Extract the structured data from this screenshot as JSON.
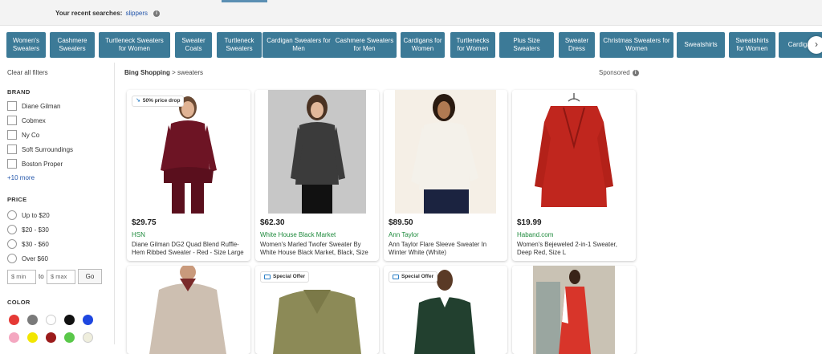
{
  "recent_searches": {
    "label": "Your recent searches:",
    "term": "slippers"
  },
  "chips": [
    "Women's Sweaters",
    "Cashmere Sweaters",
    "Turtleneck Sweaters for Women",
    "Sweater Coats",
    "Turtleneck Sweaters",
    "Cardigan Sweaters for Men",
    "Cashmere Sweaters for Men",
    "Cardigans for Women",
    "Turtlenecks for Women",
    "Plus Size Sweaters",
    "Sweater Dress",
    "Christmas Sweaters for Women",
    "Sweatshirts",
    "Sweatshirts for Women",
    "Cardigans"
  ],
  "sidebar": {
    "clear_all": "Clear all filters",
    "brand_title": "BRAND",
    "brands": [
      "Diane Gilman",
      "Cobmex",
      "Ny Co",
      "Soft Surroundings",
      "Boston Proper"
    ],
    "more": "+10 more",
    "price_title": "PRICE",
    "prices": [
      "Up to $20",
      "$20 - $30",
      "$30 - $60",
      "Over $60"
    ],
    "min_placeholder": "$ min",
    "to": "to",
    "max_placeholder": "$ max",
    "go": "Go",
    "color_title": "COLOR",
    "colors": [
      "#e53935",
      "#7a7a7a",
      "#ffffff",
      "#111111",
      "#1e47e0",
      "#f4a7c0",
      "#f2e600",
      "#9b1b1b",
      "#5ac84a",
      "#efeedd"
    ]
  },
  "breadcrumb": {
    "source": "Bing Shopping",
    "sep": ">",
    "query": "sweaters"
  },
  "sponsored": "Sponsored",
  "products": [
    {
      "price": "$29.75",
      "seller": "HSN",
      "title": "Diane Gilman DG2 Quad Blend Ruffle-Hem Ribbed Sweater - Red - Size Large",
      "badge": "50% price drop"
    },
    {
      "price": "$62.30",
      "seller": "White House Black Market",
      "title": "Women's Marled Twofer Sweater By White House Black Market, Black, Size",
      "badge": ""
    },
    {
      "price": "$89.50",
      "seller": "Ann Taylor",
      "title": "Ann Taylor Flare Sleeve Sweater In Winter White (White)",
      "badge": ""
    },
    {
      "price": "$19.99",
      "seller": "Haband.com",
      "title": "Women's Bejeweled 2-in-1 Sweater, Deep Red, Size L",
      "badge": ""
    }
  ],
  "products_row2": [
    {
      "badge": ""
    },
    {
      "badge": "Special Offer"
    },
    {
      "badge": "Special Offer"
    },
    {
      "badge": ""
    }
  ]
}
